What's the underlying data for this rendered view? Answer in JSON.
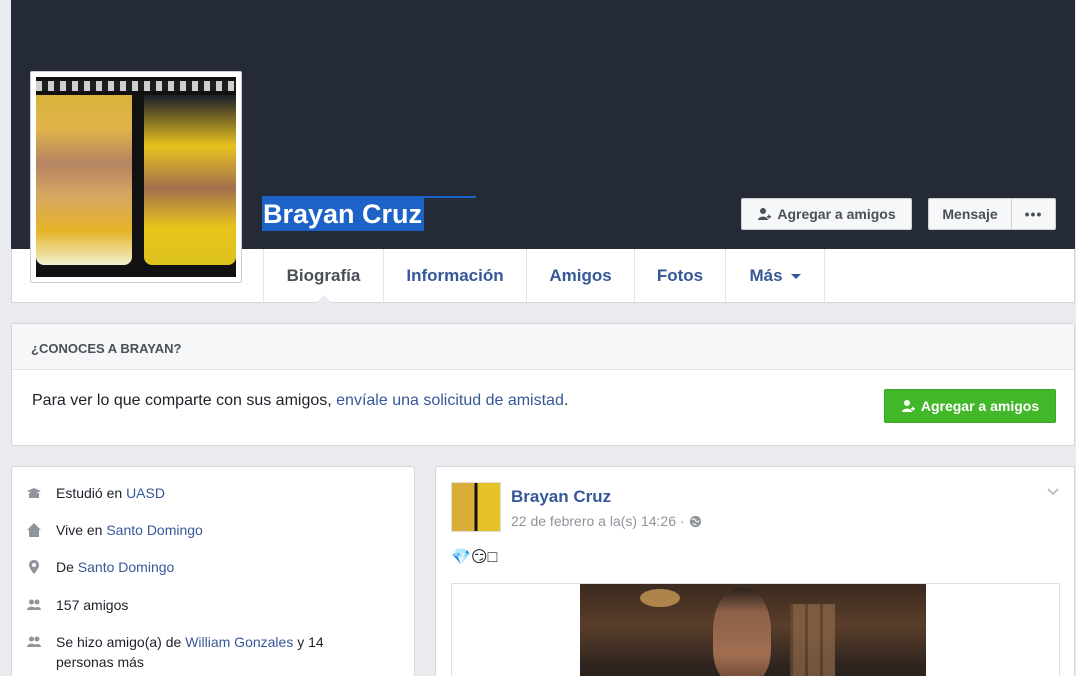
{
  "profile": {
    "name": "Brayan Cruz"
  },
  "cover_actions": {
    "add_friend": "Agregar a amigos",
    "message": "Mensaje",
    "more": "•••"
  },
  "tabs": [
    {
      "label": "Biografía",
      "active": true
    },
    {
      "label": "Información"
    },
    {
      "label": "Amigos"
    },
    {
      "label": "Fotos"
    },
    {
      "label": "Más"
    }
  ],
  "know_box": {
    "heading": "¿CONOCES A BRAYAN?",
    "text_before": "Para ver lo que comparte con sus amigos, ",
    "link": "envíale una solicitud de amistad",
    "text_after": ".",
    "button": "Agregar a amigos"
  },
  "intro": {
    "studied_prefix": "Estudió en ",
    "studied_link": "UASD",
    "lives_prefix": "Vive en ",
    "lives_link": "Santo Domingo",
    "from_prefix": "De ",
    "from_link": "Santo Domingo",
    "friends_count": "157 amigos",
    "became_friends_prefix": "Se hizo amigo(a) de ",
    "became_friends_link": "William Gonzales",
    "became_friends_suffix": " y 14",
    "became_friends_more": "personas más"
  },
  "post": {
    "author": "Brayan Cruz",
    "timestamp": "22 de febrero a la(s) 14:26",
    "separator": "·",
    "emoji_text": "💎😏□"
  },
  "colors": {
    "cover": "#252a37",
    "link": "#365899",
    "green_button": "#42b72a",
    "selection": "#1d63c7"
  }
}
